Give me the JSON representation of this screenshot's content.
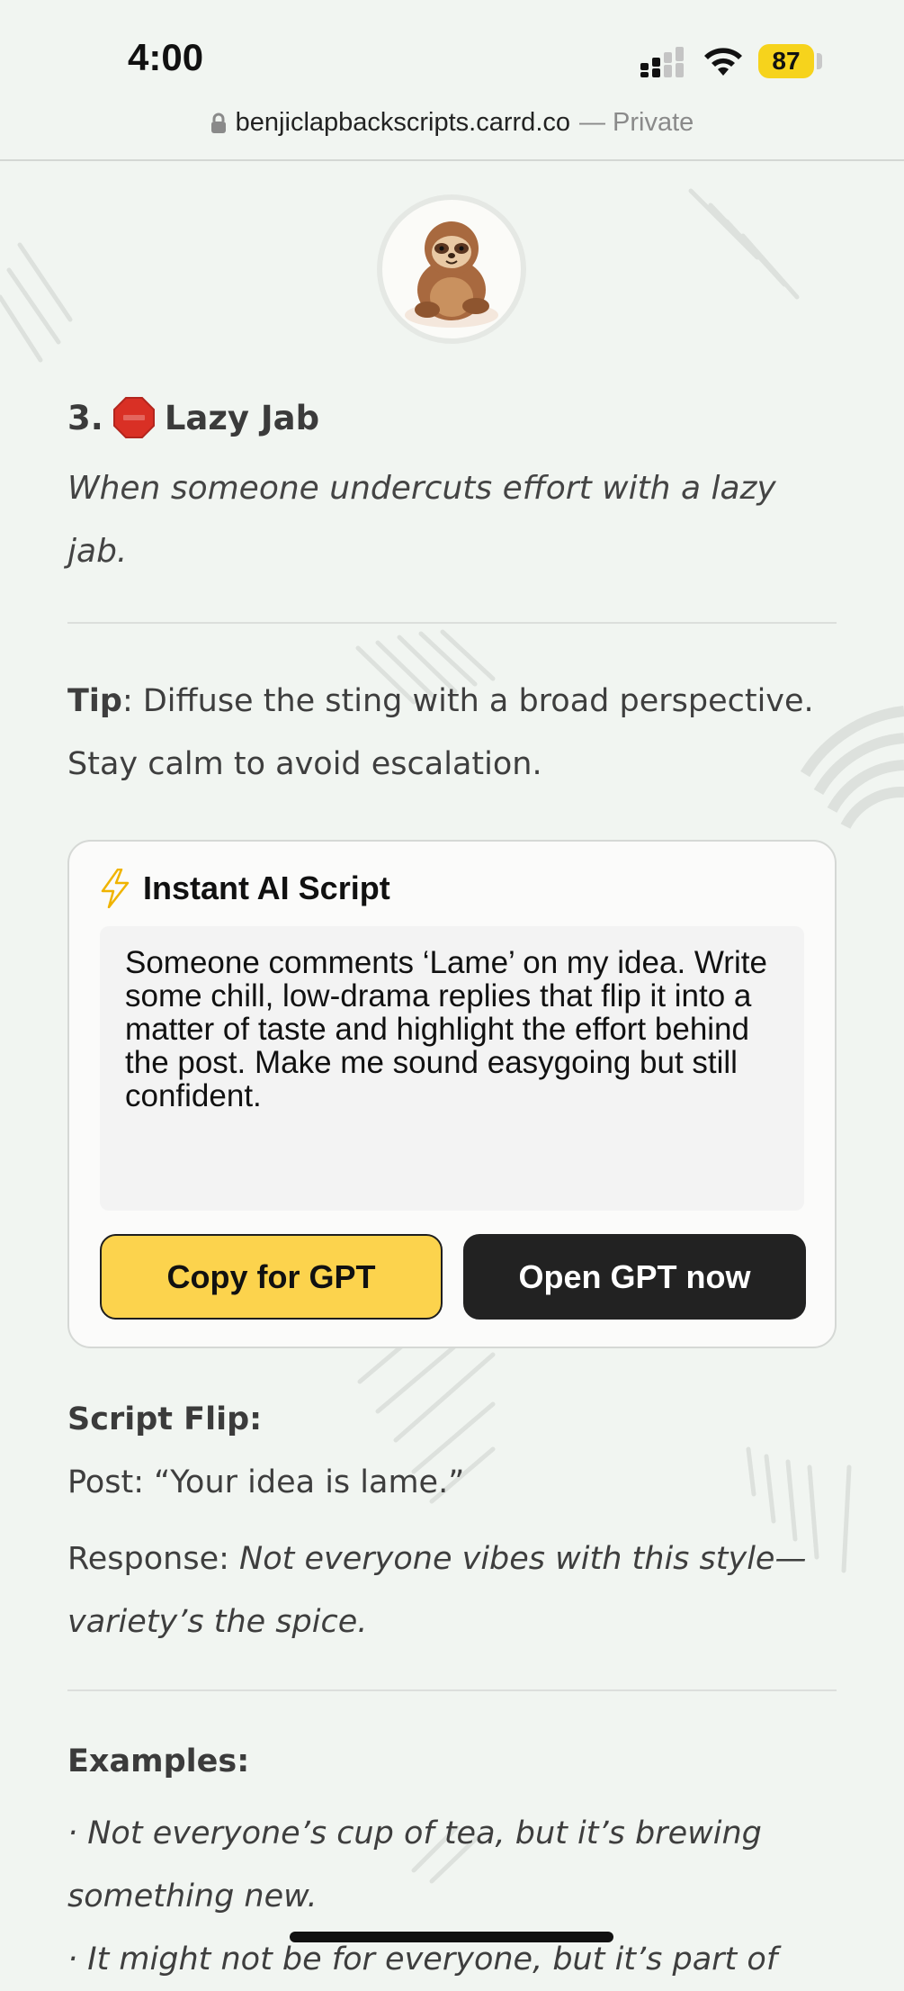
{
  "status_bar": {
    "time": "4:00",
    "battery": "87",
    "icons": [
      "signal-icon",
      "wifi-icon",
      "battery-icon"
    ]
  },
  "url_bar": {
    "domain": "benjiclapbackscripts.carrd.co",
    "suffix": "— Private",
    "icon": "lock-icon"
  },
  "avatar": {
    "icon": "sloth-avatar"
  },
  "section": {
    "number": "3.",
    "emoji": "stop-sign-icon",
    "title": "Lazy Jab",
    "subtitle": "When someone undercuts effort with a lazy jab.",
    "tip_label": "Tip",
    "tip_text": ": Diffuse the sting with a broad perspective. Stay calm to avoid escalation."
  },
  "script_card": {
    "icon": "lightning-icon",
    "title": "Instant AI Script",
    "prompt": "Someone comments ‘Lame’ on my idea. Write some chill, low-drama replies that flip it into a matter of taste and highlight the effort behind the post. Make me sound easygoing but still confident.",
    "copy_label": "Copy for GPT",
    "open_label": "Open GPT now"
  },
  "script_flip": {
    "title": "Script Flip:",
    "post_label": "Post:",
    "post_text": "“Your idea is lame.”",
    "response_label": "Response:",
    "response_text": "Not everyone vibes with this style—variety’s the spice."
  },
  "examples": {
    "title": "Examples:",
    "items": [
      "· Not everyone’s cup of tea, but it’s brewing something new.",
      "· It might not be for everyone, but it’s part of"
    ]
  },
  "colors": {
    "background": "#f1f5f1",
    "accent_yellow": "#fcd34d",
    "dark_button": "#222222",
    "battery": "#f6d31c"
  }
}
